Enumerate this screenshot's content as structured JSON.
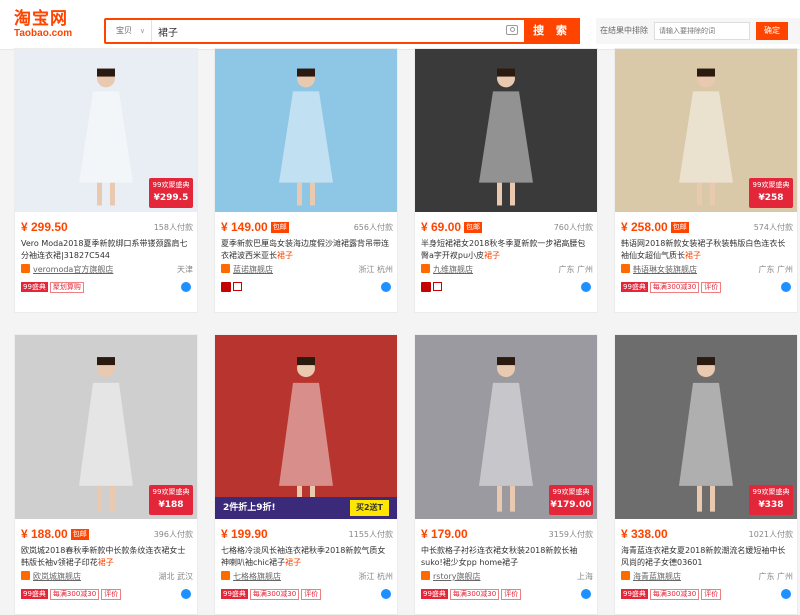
{
  "header": {
    "logo_cn": "淘宝网",
    "logo_en": "Taobao.com",
    "search_category": "宝贝",
    "search_query": "裙子",
    "search_button": "搜 索",
    "filter_label": "在结果中排除",
    "filter_placeholder": "请输入要排除的词",
    "filter_button": "确定"
  },
  "products": [
    {
      "price": "¥ 299.50",
      "post_tag": "",
      "sales": "158人付款",
      "title": "Vero Moda2018夏季新款绑口系带镂颈露肩七分袖连衣裙|31827C544",
      "highlight": "",
      "shop": "veromoda官方旗舰店",
      "location": "天津",
      "badge_price": "¥299.5",
      "badges": [
        "99盛典",
        "聚划算购"
      ],
      "image_bg": "#e8eef4"
    },
    {
      "price": "¥ 149.00",
      "post_tag": "包邮",
      "sales": "656人付款",
      "title": "夏季新款巴厘岛女装海边度假沙滩裙露背吊带连衣裙波西米亚长",
      "highlight": "裙子",
      "shop": "蓝诺旗舰店",
      "location": "浙江 杭州",
      "badge_price": "",
      "badges": [],
      "image_bg": "#8ec7e6"
    },
    {
      "price": "¥ 69.00",
      "post_tag": "包邮",
      "sales": "760人付款",
      "title": "半身短裙裙女2018秋冬季夏新款一步裙高腰包臀a字开衩pu小皮",
      "highlight": "裙子",
      "shop": "九维旗舰店",
      "location": "广东 广州",
      "badge_price": "",
      "badges": [],
      "image_bg": "#3a3a3a"
    },
    {
      "price": "¥ 258.00",
      "post_tag": "包邮",
      "sales": "574人付款",
      "title": "韩语网2018新款女装裙子秋装韩版白色连衣长袖仙女超仙气质长",
      "highlight": "裙子",
      "shop": "韩语琳女装旗舰店",
      "location": "广东 广州",
      "badge_price": "¥258",
      "badges": [
        "99盛典",
        "每满300减30",
        "评价"
      ],
      "image_bg": "#d9c9a8"
    },
    {
      "price": "¥ 188.00",
      "post_tag": "包邮",
      "sales": "396人付款",
      "title": "欧岚城2018春秋季新款中长款条纹连衣裙女士韩版长袖v领裙子印花",
      "highlight": "裙子",
      "shop": "欧岚城旗舰店",
      "location": "湖北 武汉",
      "badge_price": "¥188",
      "badges": [
        "99盛典",
        "每满300减30",
        "评价"
      ],
      "image_bg": "#cfcfcf"
    },
    {
      "price": "¥ 199.90",
      "post_tag": "",
      "sales": "1155人付款",
      "title": "七格格冷淡风长袖连衣裙秋季2018新款气质女神喇叭袖chic裙子",
      "highlight": "裙子",
      "shop": "七格格旗舰店",
      "location": "浙江 杭州",
      "badge_price": "",
      "badges": [
        "99盛典",
        "每满300减30",
        "评价"
      ],
      "image_bg": "#b8342e",
      "promo_a": "2件折上9折!",
      "promo_b": "买2送T"
    },
    {
      "price": "¥ 179.00",
      "post_tag": "",
      "sales": "3159人付款",
      "title": "中长款格子衬衫连衣裙女秋装2018新款长袖suko!裙少女pp home裙子",
      "highlight": "",
      "shop": "rstory旗舰店",
      "location": "上海",
      "badge_price": "¥179.00",
      "badges": [
        "99盛典",
        "每满300减30",
        "评价"
      ],
      "image_bg": "#9a9aa0"
    },
    {
      "price": "¥ 338.00",
      "post_tag": "",
      "sales": "1021人付款",
      "title": "海青蓝连衣裙女夏2018新款潮流名媛短袖中长风尚的裙子女德03601",
      "highlight": "",
      "shop": "海青蓝旗舰店",
      "location": "广东 广州",
      "badge_price": "¥338",
      "badges": [
        "99盛典",
        "每满300减30",
        "评价"
      ],
      "image_bg": "#6d6d6d"
    }
  ]
}
